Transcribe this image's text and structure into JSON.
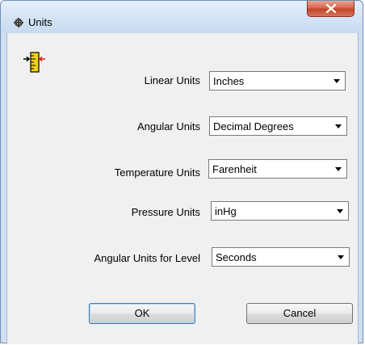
{
  "window": {
    "title": "Units",
    "close_symbol": "X",
    "app_icon": "settings-app-icon"
  },
  "header_icon": "ruler-arrows-icon",
  "fields": {
    "linear_units": {
      "label": "Linear Units",
      "value": "Inches"
    },
    "angular_units": {
      "label": "Angular Units",
      "value": "Decimal Degrees"
    },
    "temperature_units": {
      "label": "Temperature Units",
      "value": "Farenheit"
    },
    "pressure_units": {
      "label": "Pressure Units",
      "value": "inHg"
    },
    "angular_units_level": {
      "label": "Angular Units for Level",
      "value": "Seconds"
    }
  },
  "buttons": {
    "ok": "OK",
    "cancel": "Cancel"
  },
  "colors": {
    "title_bar": "#d4e3f4",
    "close_button": "#c2442a",
    "dialog_background": "#f0f0f0",
    "default_button_border": "#3c7fb1"
  }
}
